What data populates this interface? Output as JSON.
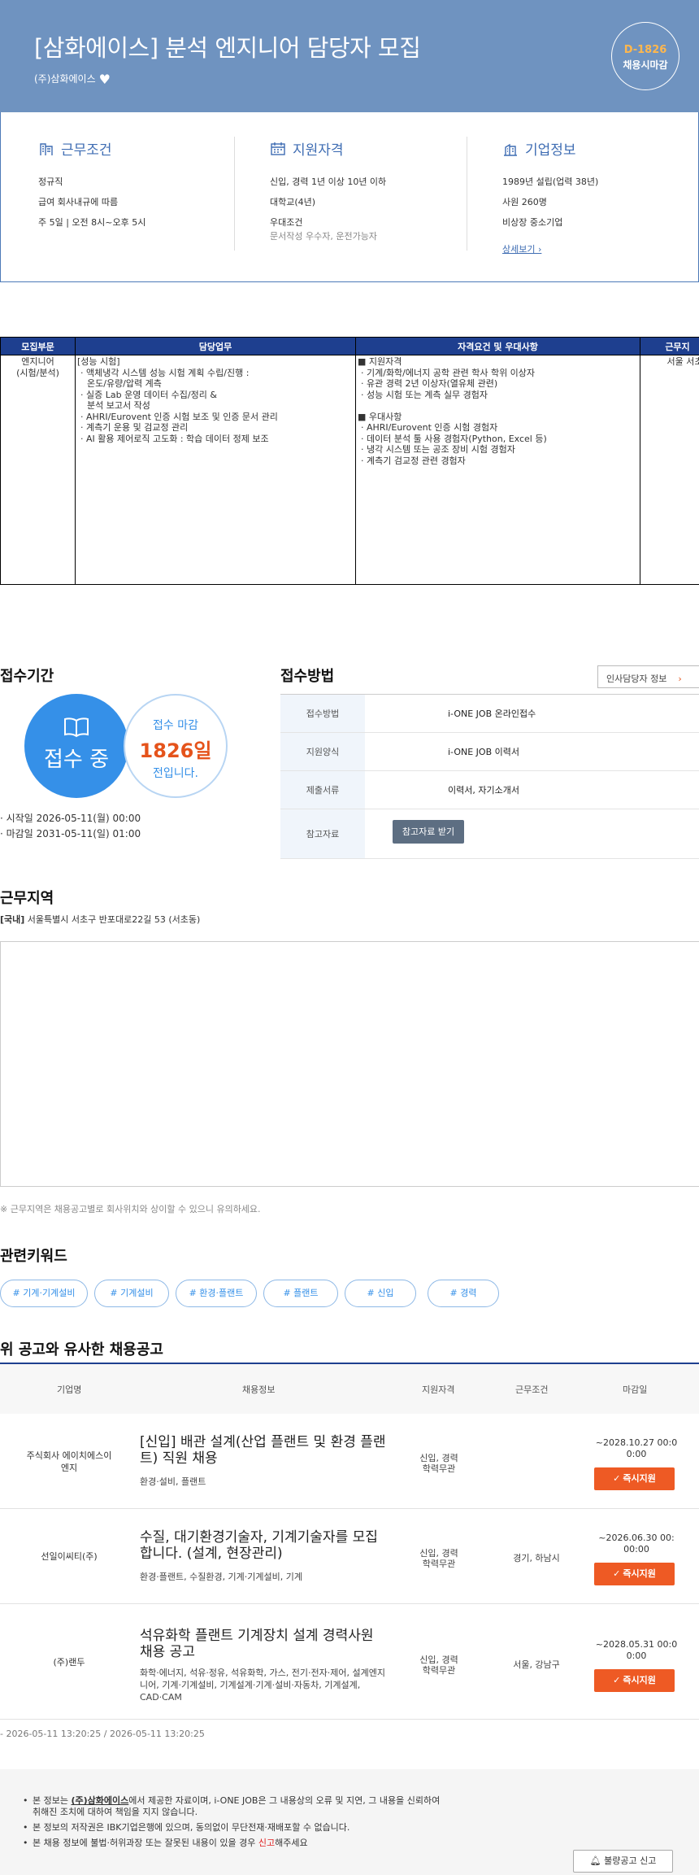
{
  "header": {
    "title": "[삼화에이스] 분석 엔지니어 담당자 모집",
    "company": "(주)삼화에이스",
    "dday": "D-1826",
    "dday_status": "채용시마감"
  },
  "summary": {
    "work": {
      "title": "근무조건",
      "items": [
        "정규직",
        "급여 회사내규에 따름",
        "주 5일 | 오전 8시~오후 5시"
      ]
    },
    "qual": {
      "title": "지원자격",
      "items": [
        "신입, 경력 1년 이상 10년 이하",
        "대학교(4년)",
        "우대조건"
      ],
      "sub": "문서작성 우수자, 운전가능자"
    },
    "company": {
      "title": "기업정보",
      "items": [
        "1989년 설립(업력 38년)",
        "사원 260명",
        "비상장 중소기업"
      ],
      "more": "상세보기"
    }
  },
  "detail": {
    "headers": [
      "모집부문",
      "담당업무",
      "자격요건 및 우대사항",
      "근무지"
    ],
    "dept": "엔지니어\n(시험/분석)",
    "duties": [
      "[성능 시험]",
      "· 액체냉각 시스템 성능 시험 계획 수립/진행 :",
      "  온도/유량/압력 계측",
      "· 실증 Lab 운영 데이터 수집/정리 &",
      "  분석 보고서 작성",
      "· AHRI/Eurovent 인증 시험 보조 및 인증 문서 관리",
      "· 계측기 운용 및 검교정 관리",
      "· AI 활용 제어로직 고도화 : 학습 데이터 정제 보조"
    ],
    "quals": [
      "■ 지원자격",
      "· 기계/화학/에너지 공학 관련 학사 학위 이상자",
      "· 유관 경력 2년 이상자(열유체 관련)",
      "· 성능 시험 또는 계측 실무 경험자",
      "",
      "■ 우대사항",
      "· AHRI/Eurovent 인증 시험 경험자",
      "· 데이터 분석 툴 사용 경험자(Python, Excel 등)",
      "· 냉각 시스템 또는 공조 장비 시험 경험자",
      "· 계측기 검교정 관련 경험자"
    ],
    "location": "서울 서초"
  },
  "period": {
    "title": "접수기간",
    "status": "접수 중",
    "deadline_label": "접수 마감",
    "days": "1826일",
    "days_suffix": "전입니다.",
    "start": "· 시작일 2026-05-11(월) 00:00",
    "end": "· 마감일 2031-05-11(일) 01:00"
  },
  "apply": {
    "title": "접수방법",
    "hr_button": "인사담당자 정보",
    "rows": [
      {
        "k": "접수방법",
        "v": "i-ONE JOB 온라인접수"
      },
      {
        "k": "지원양식",
        "v": "i-ONE JOB 이력서"
      },
      {
        "k": "제출서류",
        "v": "이력서, 자기소개서"
      },
      {
        "k": "참고자료",
        "v": ""
      }
    ],
    "ref_button": "참고자료 받기"
  },
  "location": {
    "title": "근무지역",
    "tag": "[국내]",
    "address": "서울특별시 서초구 반포대로22길 53 (서초동)",
    "note": "※ 근무지역은 채용공고별로 회사위치와 상이할 수 있으니 유의하세요."
  },
  "keywords": {
    "title": "관련키워드",
    "items": [
      "# 기계·기계설비",
      "# 기계설비",
      "# 환경·플랜트",
      "# 플랜트",
      "# 신입",
      "# 경력"
    ]
  },
  "similar": {
    "title": "위 공고와 유사한 채용공고",
    "headers": [
      "기업명",
      "채용정보",
      "지원자격",
      "근무조건",
      "마감일"
    ],
    "rows": [
      {
        "company": "주식회사 에이치에스이\n엔지",
        "title": "[신입] 배관 설계(산업 플랜트 및 환경 플랜트) 직원 채용",
        "tags": "환경·설비, 플랜트",
        "qual": "신입, 경력\n학력무관",
        "loc": "",
        "deadline": "~2028.10.27 00:0\n0:00",
        "btn": "즉시지원"
      },
      {
        "company": "선일이씨티(주)",
        "title": "수질, 대기환경기술자, 기계기술자를 모집합니다. (설계, 현장관리)",
        "tags": "환경·플랜트, 수질환경, 기계·기계설비, 기계",
        "qual": "신입, 경력\n학력무관",
        "loc": "경기, 하남시",
        "deadline": "~2026.06.30 00:\n00:00",
        "btn": "즉시지원"
      },
      {
        "company": "(주)랜두",
        "title": "석유화학 플랜트 기계장치 설계 경력사원 채용 공고",
        "tags": "화학·에너지, 석유·정유, 석유화학, 가스, 전기·전자·제어, 설계엔지니어, 기계·기계설비, 기계설계·기계·설비·자동차, 기계설계, CAD·CAM",
        "qual": "신입, 경력\n학력무관",
        "loc": "서울, 강남구",
        "deadline": "~2028.05.31 00:0\n0:00",
        "btn": "즉시지원"
      }
    ]
  },
  "timestamp": "- 2026-05-11 13:20:25 / 2026-05-11 13:20:25",
  "footer": {
    "line1_a": "본 정보는 ",
    "line1_co": "(주)삼화에이스",
    "line1_b": "에서 제공한 자료이며, i-ONE JOB은 그 내용상의 오류 및 지연, 그 내용을 신뢰하여",
    "line1_c": "취해진 조치에 대하여 책임을 지지 않습니다.",
    "line2": "본 정보의 저작권은 IBK기업은행에 있으며, 동의없이 무단전재·재배포할 수 없습니다.",
    "line3_a": "본 채용 정보에 불법·허위과장 또는 잘못된 내용이 있을 경우 ",
    "line3_red": "신고",
    "line3_b": "해주세요",
    "report": "불량공고 신고"
  },
  "colors": {
    "hero": "#6f93c0",
    "accent": "#3f6db3",
    "table_header": "#1e3f8f",
    "apply_button": "#ee5a24",
    "days": "#e5531b",
    "circle": "#3590e8"
  }
}
